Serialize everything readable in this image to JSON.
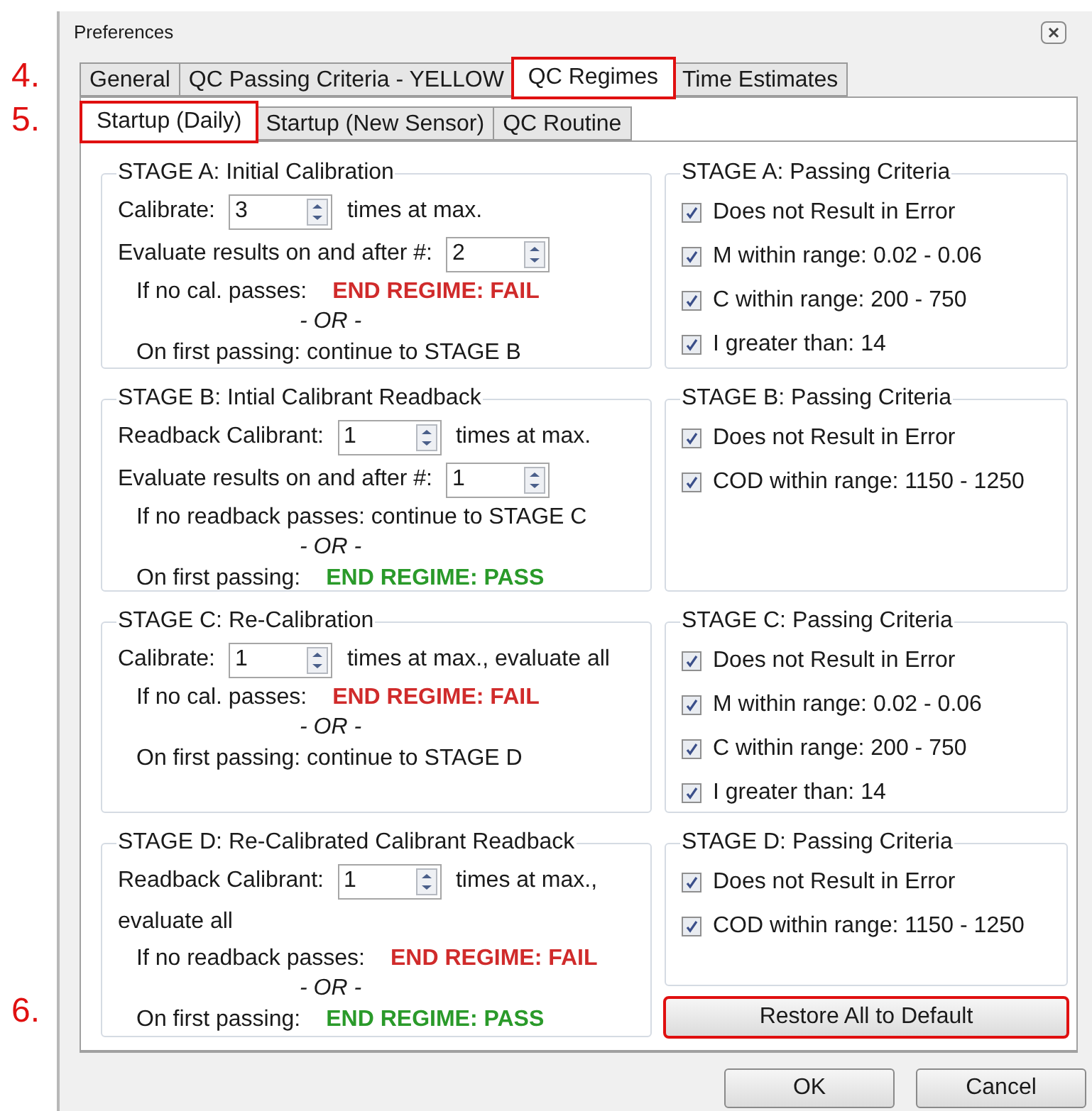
{
  "window": {
    "title": "Preferences"
  },
  "tabs": [
    {
      "label": "General",
      "selected": false,
      "highlighted": false
    },
    {
      "label": "QC Passing Criteria - YELLOW",
      "selected": false,
      "highlighted": false
    },
    {
      "label": "QC Regimes",
      "selected": true,
      "highlighted": true,
      "callout": "4."
    },
    {
      "label": "Time Estimates",
      "selected": false,
      "highlighted": false
    }
  ],
  "subtabs": [
    {
      "label": "Startup (Daily)",
      "selected": true,
      "highlighted": true,
      "callout": "5."
    },
    {
      "label": "Startup (New Sensor)",
      "selected": false,
      "highlighted": false
    },
    {
      "label": "QC Routine",
      "selected": false,
      "highlighted": false
    }
  ],
  "stages": [
    {
      "title": "STAGE A: Initial Calibration",
      "rows": [
        {
          "kind": "spin",
          "label": "Calibrate:",
          "value": "3",
          "suffix": "times at max."
        },
        {
          "kind": "spin",
          "label": "Evaluate results on and after #:",
          "value": "2"
        },
        {
          "kind": "outcome",
          "label": "If no cal. passes:",
          "result": "END REGIME: FAIL",
          "color": "#d02b2b"
        },
        {
          "kind": "or",
          "text": "- OR -"
        },
        {
          "kind": "outcome",
          "label": "On first passing: continue to STAGE B"
        }
      ]
    },
    {
      "title": "STAGE B: Intial Calibrant Readback",
      "rows": [
        {
          "kind": "spin",
          "label": "Readback Calibrant:",
          "value": "1",
          "suffix": "times at max."
        },
        {
          "kind": "spin",
          "label": "Evaluate results on and after #:",
          "value": "1"
        },
        {
          "kind": "outcome",
          "label": "If no readback passes: continue to STAGE C"
        },
        {
          "kind": "or",
          "text": "- OR -"
        },
        {
          "kind": "outcome",
          "label": "On first passing:",
          "result": "END REGIME: PASS",
          "color": "#2a9a2a"
        }
      ]
    },
    {
      "title": "STAGE C: Re-Calibration",
      "rows": [
        {
          "kind": "spin",
          "label": "Calibrate:",
          "value": "1",
          "suffix": "times at max., evaluate all"
        },
        {
          "kind": "outcome",
          "label": "If no cal. passes:",
          "result": "END REGIME: FAIL",
          "color": "#d02b2b"
        },
        {
          "kind": "or",
          "text": "- OR -"
        },
        {
          "kind": "outcome",
          "label": "On first passing: continue to STAGE D"
        }
      ]
    },
    {
      "title": "STAGE D: Re-Calibrated Calibrant Readback",
      "rows": [
        {
          "kind": "spin",
          "label": "Readback Calibrant:",
          "value": "1",
          "suffix": "times at max.,"
        },
        {
          "kind": "line",
          "text": "evaluate all"
        },
        {
          "kind": "outcome",
          "label": "If no readback passes:",
          "result": "END REGIME: FAIL",
          "color": "#d02b2b"
        },
        {
          "kind": "or",
          "text": "- OR -"
        },
        {
          "kind": "outcome",
          "label": "On first passing:",
          "result": "END REGIME: PASS",
          "color": "#2a9a2a"
        }
      ]
    }
  ],
  "criteria": [
    {
      "title": "STAGE A: Passing Criteria",
      "items": [
        {
          "label": "Does not Result in Error",
          "checked": true
        },
        {
          "label": "M within range: 0.02 - 0.06",
          "checked": true
        },
        {
          "label": "C within range: 200 - 750",
          "checked": true
        },
        {
          "label": "I greater than: 14",
          "checked": true
        }
      ]
    },
    {
      "title": "STAGE B: Passing Criteria",
      "items": [
        {
          "label": "Does not Result in Error",
          "checked": true
        },
        {
          "label": "COD within range: 1150 - 1250",
          "checked": true
        }
      ]
    },
    {
      "title": "STAGE C: Passing Criteria",
      "items": [
        {
          "label": "Does not Result in Error",
          "checked": true
        },
        {
          "label": "M within range: 0.02 - 0.06",
          "checked": true
        },
        {
          "label": "C within range: 200 - 750",
          "checked": true
        },
        {
          "label": "I greater than: 14",
          "checked": true
        }
      ]
    },
    {
      "title": "STAGE D: Passing Criteria",
      "items": [
        {
          "label": "Does not Result in Error",
          "checked": true
        },
        {
          "label": "COD within range: 1150 - 1250",
          "checked": true
        }
      ]
    }
  ],
  "restore_button": {
    "label": "Restore All to Default",
    "highlighted": true,
    "callout": "6."
  },
  "buttons": [
    {
      "label": "OK"
    },
    {
      "label": "Cancel"
    }
  ]
}
